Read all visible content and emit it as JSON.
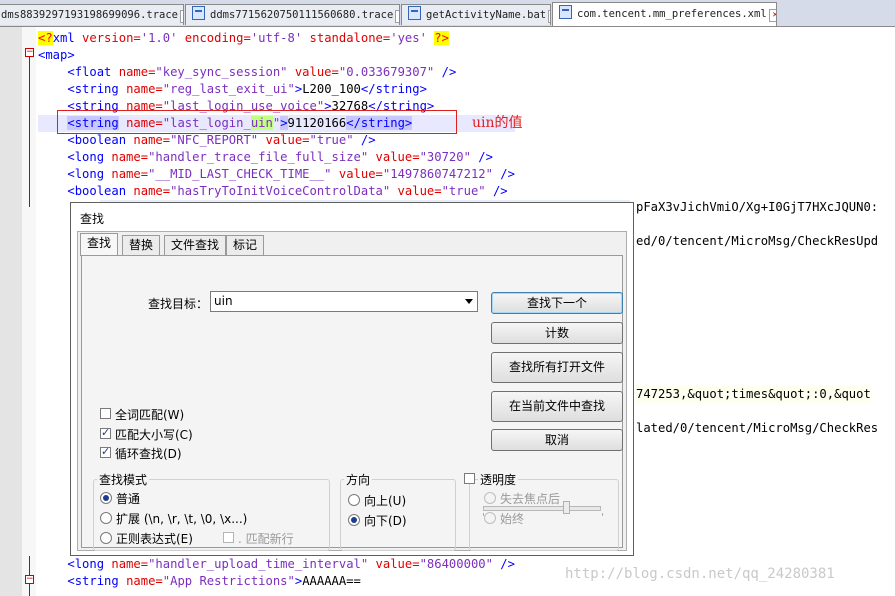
{
  "tabs": [
    {
      "label": "dms8839297193198699096.trace",
      "active": false
    },
    {
      "label": "ddms7715620750111560680.trace",
      "active": false
    },
    {
      "label": "getActivityName.bat",
      "active": false
    },
    {
      "label": "com.tencent.mm_preferences.xml",
      "active": true
    }
  ],
  "code": {
    "l1": {
      "open": "<?",
      "name": "xml",
      "a1": " version=",
      "v1": "'1.0'",
      "a2": " encoding=",
      "v2": "'utf-8'",
      "a3": " standalone=",
      "v3": "'yes'",
      "close": "?>"
    },
    "l2": {
      "tag": "<map>"
    },
    "l3": {
      "tag": "<float",
      "attr": " name=",
      "val": "\"key_sync_session\"",
      "attr2": " value=",
      "val2": "\"0.033679307\"",
      "end": " />"
    },
    "l4": {
      "tag": "<string",
      "attr": " name=",
      "val": "\"reg_last_exit_ui\"",
      "gt": ">",
      "text": "L200_100",
      "end": "</string>"
    },
    "l5": {
      "tag": "<string",
      "attr": " name=",
      "val": "\"last_login_use_voice\"",
      "gt": ">",
      "text": "32768",
      "end": "</string>"
    },
    "l6": {
      "tag": "<string",
      "attr": " name=",
      "valpre": "\"last_login_",
      "valmatch": "uin",
      "valpost": "\"",
      "gt": ">",
      "text": "91120166",
      "end": "</string>"
    },
    "l7": {
      "tag": "<boolean",
      "attr": " name=",
      "val": "\"NFC_REPORT\"",
      "attr2": " value=",
      "val2": "\"true\"",
      "end": " />"
    },
    "l8": {
      "tag": "<long",
      "attr": " name=",
      "val": "\"handler_trace_file_full_size\"",
      "attr2": " value=",
      "val2": "\"30720\"",
      "end": " />"
    },
    "l9": {
      "tag": "<long",
      "attr": " name=",
      "val": "\"__MID_LAST_CHECK_TIME__\"",
      "attr2": " value=",
      "val2": "\"1497860747212\"",
      "end": " />"
    },
    "l10": {
      "tag": "<boolean",
      "attr": " name=",
      "val": "\"hasTryToInitVoiceControlData\"",
      "attr2": " value=",
      "val2": "\"true\"",
      "end": " />"
    },
    "lb1": {
      "tag": "<long",
      "attr": " name=",
      "val": "\"handler_upload_time_interval\"",
      "attr2": " value=",
      "val2": "\"86400000\"",
      "end": " />"
    },
    "lb2": {
      "tag": "<string",
      "attr": " name=",
      "val": "\"App Restrictions\"",
      "gt": ">",
      "text": "AAAAAA=="
    }
  },
  "side_fragments": {
    "f1": "pFaX3vJichVmiO/Xg+I0GjT7HXcJQUN0:",
    "f2": "ed/0/tencent/MicroMsg/CheckResUpd",
    "f3": "747253,&quot;times&quot;:0,&quot",
    "f4": "lated/0/tencent/MicroMsg/CheckRes"
  },
  "annotation": "uin的值",
  "watermark": "http://blog.csdn.net/qq_24280381",
  "dialog": {
    "title": "查找",
    "tabs": [
      "查找",
      "替换",
      "文件查找",
      "标记"
    ],
    "find_label": "查找目标：",
    "find_value": "uin",
    "buttons": {
      "find_next": "查找下一个",
      "count": "计数",
      "find_all_open": "查找所有打开文件",
      "find_in_current": "在当前文件中查找",
      "cancel": "取消"
    },
    "options": {
      "whole_word": "全词匹配(W)",
      "match_case": "匹配大小写(C)",
      "wrap": "循环查找(D)"
    },
    "mode": {
      "title": "查找模式",
      "normal": "普通",
      "extended": "扩展 (\\n, \\r, \\t, \\0, \\x...)",
      "regex": "正则表达式(E)",
      "dot_newline": ". 匹配新行"
    },
    "direction": {
      "title": "方向",
      "up": "向上(U)",
      "down": "向下(D)"
    },
    "transparency": {
      "title": "透明度",
      "on_lose_focus": "失去焦点后",
      "always": "始终"
    }
  }
}
